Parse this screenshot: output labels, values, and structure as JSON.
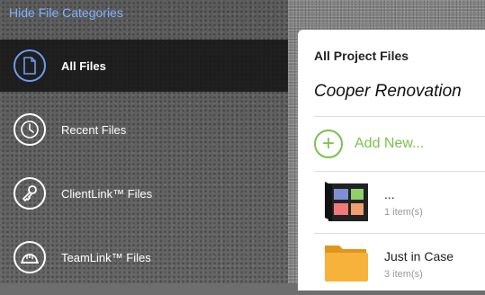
{
  "header": {
    "hide_categories": "Hide File Categories"
  },
  "sidebar": {
    "items": [
      {
        "label": "All Files",
        "icon": "document-icon",
        "active": true
      },
      {
        "label": "Recent Files",
        "icon": "clock-icon",
        "active": false
      },
      {
        "label": "ClientLink™ Files",
        "icon": "key-icon",
        "active": false
      },
      {
        "label": "TeamLink™ Files",
        "icon": "hardhat-icon",
        "active": false
      }
    ]
  },
  "panel": {
    "title": "All Project Files",
    "project_name": "Cooper Renovation",
    "add_new_label": "Add New...",
    "files": [
      {
        "name": "...",
        "count": "1 item(s)",
        "icon": "gallery-folder-icon"
      },
      {
        "name": "Just in Case",
        "count": "3 item(s)",
        "icon": "folder-icon"
      }
    ]
  },
  "colors": {
    "accent_blue": "#6e9cf0",
    "link_blue": "#7fb2ff",
    "add_green": "#7cc04b",
    "folder_orange": "#f5a623"
  }
}
